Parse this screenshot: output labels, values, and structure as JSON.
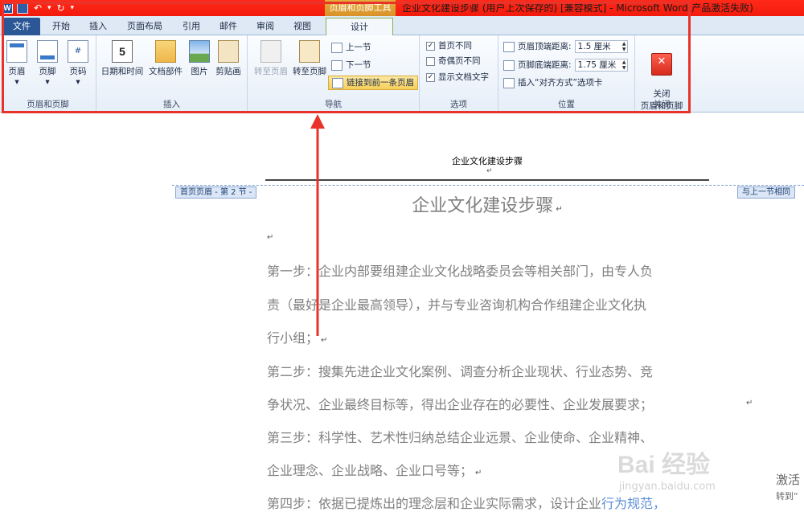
{
  "titlebar": {
    "contextual_tab_header": "页眉和页脚工具",
    "window_title": "企业文化建设步骤 (用户上次保存的) [兼容模式] - Microsoft Word(产品激活失败)",
    "word_logo": "W"
  },
  "tabs": [
    "文件",
    "开始",
    "插入",
    "页面布局",
    "引用",
    "邮件",
    "审阅",
    "视图",
    "设计"
  ],
  "ribbon": {
    "groups": {
      "header_footer": {
        "label": "页眉和页脚",
        "buttons": [
          "页眉",
          "页脚",
          "页码"
        ],
        "page_number_glyph": "#"
      },
      "insert": {
        "label": "插入",
        "buttons": [
          "日期和时间",
          "文档部件",
          "图片",
          "剪贴画"
        ],
        "calendar_glyph": "5"
      },
      "navigation": {
        "label": "导航",
        "goto_header": "转至页眉",
        "goto_footer": "转至页脚",
        "prev_section": "上一节",
        "next_section": "下一节",
        "link_to_previous": "链接到前一条页眉"
      },
      "options": {
        "label": "选项",
        "different_first_page": "首页不同",
        "different_odd_even": "奇偶页不同",
        "show_document_text": "显示文档文字",
        "different_first_page_checked": true,
        "different_odd_even_checked": false,
        "show_document_text_checked": true
      },
      "position": {
        "label": "位置",
        "header_from_top_label": "页眉顶端距离:",
        "header_from_top_value": "1.5 厘米",
        "footer_from_bottom_label": "页脚底端距离:",
        "footer_from_bottom_value": "1.75 厘米",
        "insert_alignment_tab": "插入“对齐方式”选项卡"
      },
      "close": {
        "label": "关闭",
        "button": "关闭\n页眉和页脚"
      }
    }
  },
  "document": {
    "header_text": "企业文化建设步骤",
    "header_tag_left": "首页页眉 - 第 2 节 -",
    "header_tag_right": "与上一节相同",
    "title": "企业文化建设步骤",
    "lines": [
      "第一步：企业内部要组建企业文化战略委员会等相关部门，由专人负",
      "责（最好是企业最高领导），并与专业咨询机构合作组建企业文化执",
      "行小组；",
      "第二步：搜集先进企业文化案例、调查分析企业现状、行业态势、竞",
      "争状况、企业最终目标等，得出企业存在的必要性、企业发展要求；",
      "第三步：科学性、艺术性归纳总结企业远景、企业使命、企业精神、",
      "企业理念、企业战略、企业口号等；",
      "第四步：依据已提炼出的理念层和企业实际需求，设计企业"
    ],
    "last_line_highlight": "行为规范，"
  },
  "watermark": {
    "brand": "Bai 经验",
    "url": "jingyan.baidu.com",
    "activate": "激活",
    "activate_sub": "转到“"
  },
  "colors": {
    "annotation_red": "#e8332a",
    "file_tab": "#2b5797",
    "contextual_tab": "#d9922a"
  }
}
